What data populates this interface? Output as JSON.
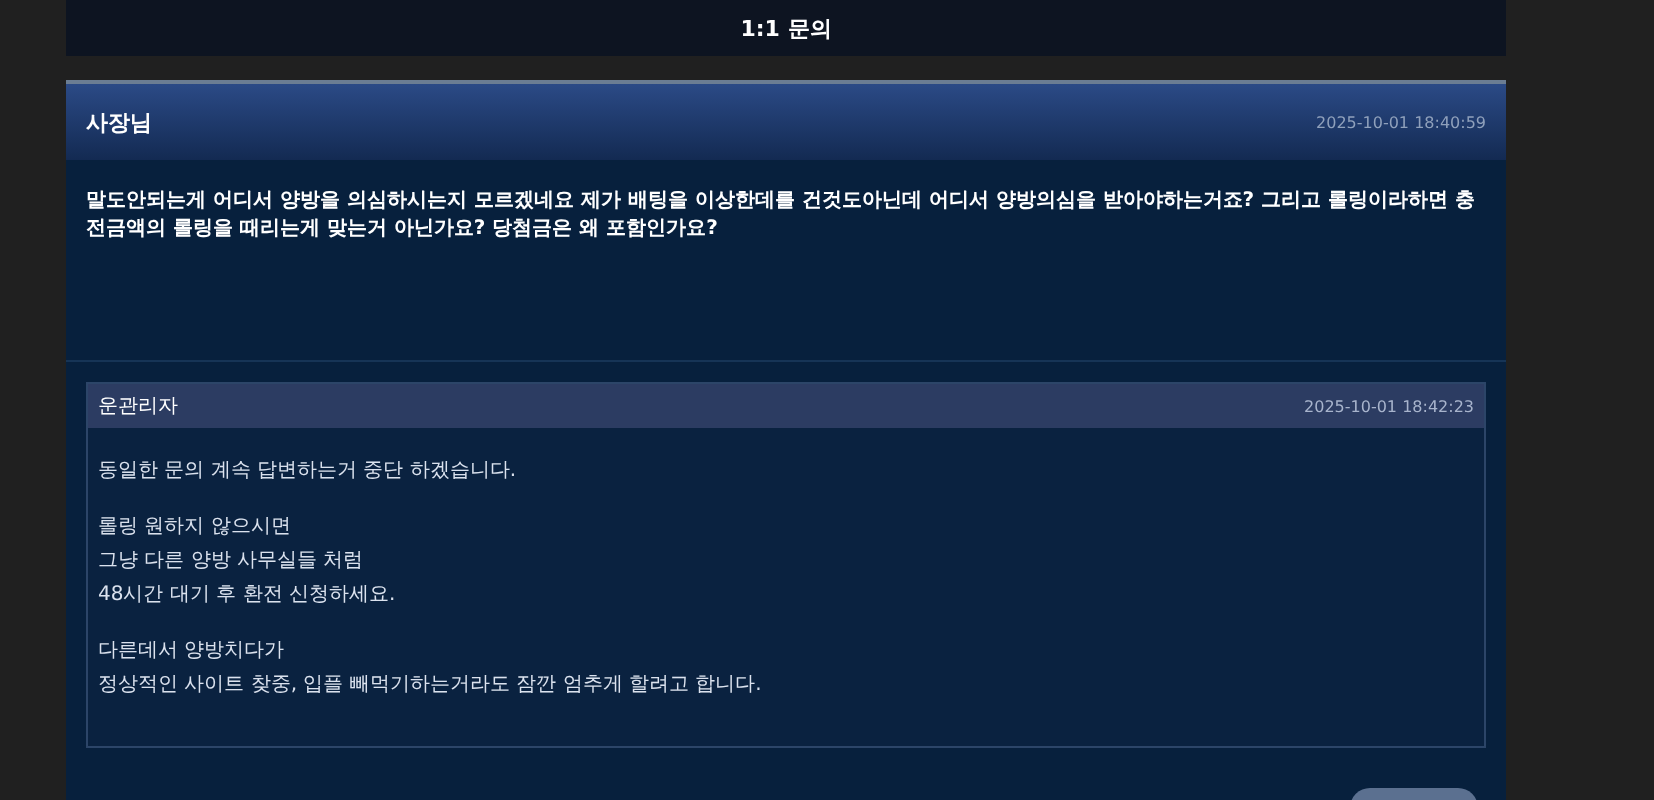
{
  "page_title": "1:1 문의",
  "question": {
    "author": "사장님",
    "date": "2025-10-01 18:40:59",
    "body": "말도안되는게 어디서 양방을 의심하시는지 모르겠네요 제가 배팅을 이상한데를 건것도아닌데 어디서 양방의심을 받아야하는거죠? 그리고 롤링이라하면 충전금액의 롤링을 때리는게 맞는거 아닌가요? 당첨금은 왜 포함인가요?"
  },
  "answer": {
    "author": "운관리자",
    "date": "2025-10-01 18:42:23",
    "paragraphs": [
      [
        "동일한 문의 계속 답변하는거 중단 하겠습니다."
      ],
      [
        "롤링 원하지 않으시면",
        "그냥 다른 양방 사무실들 처럼",
        "48시간 대기 후 환전 신청하세요."
      ],
      [
        "다른데서 양방치다가",
        "정상적인 사이트 찾중, 입플 빼먹기하는거라도 잠깐 엄추게 할려고 합니다."
      ]
    ]
  }
}
